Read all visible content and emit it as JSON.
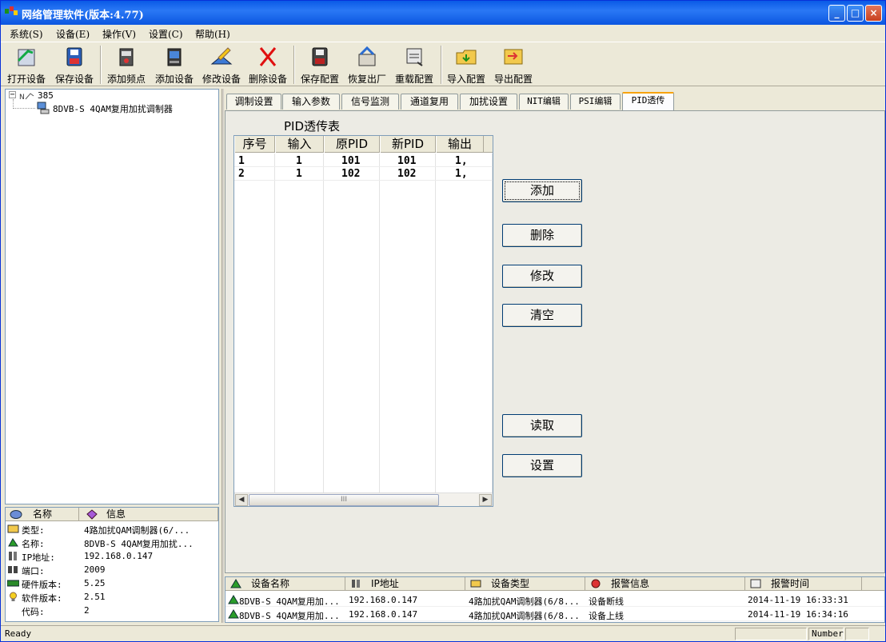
{
  "window": {
    "title": "网络管理软件(版本:4.77)",
    "minimize": "_",
    "maximize": "□",
    "close": "×"
  },
  "menu": [
    "系统(S)",
    "设备(E)",
    "操作(V)",
    "设置(C)",
    "帮助(H)"
  ],
  "toolbar": {
    "open_device": "打开设备",
    "save_device": "保存设备",
    "add_frequency": "添加频点",
    "add_device": "添加设备",
    "modify_device": "修改设备",
    "delete_device": "删除设备",
    "save_config": "保存配置",
    "factory_reset": "恢复出厂",
    "reload_config": "重载配置",
    "import_config": "导入配置",
    "export_config": "导出配置"
  },
  "tree": {
    "root_label": "385",
    "child_label": "8DVB-S 4QAM复用加扰调制器"
  },
  "properties": {
    "header_name": "名称",
    "header_info": "信息",
    "rows": [
      {
        "key": "类型:",
        "value": "4路加扰QAM调制器(6/..."
      },
      {
        "key": "名称:",
        "value": "8DVB-S 4QAM复用加扰..."
      },
      {
        "key": "IP地址:",
        "value": "192.168.0.147"
      },
      {
        "key": "端口:",
        "value": "2009"
      },
      {
        "key": "硬件版本:",
        "value": "5.25"
      },
      {
        "key": "软件版本:",
        "value": "2.51"
      },
      {
        "key": "代码:",
        "value": "2"
      }
    ]
  },
  "tabs": [
    "调制设置",
    "输入参数",
    "信号监测",
    "通道复用",
    "加扰设置",
    "NIT编辑",
    "PSI编辑",
    "PID透传"
  ],
  "pid_table": {
    "title": "PID透传表",
    "columns": [
      "序号",
      "输入",
      "原PID",
      "新PID",
      "输出"
    ],
    "rows": [
      [
        "1",
        "1",
        "101",
        "101",
        "1,"
      ],
      [
        "2",
        "1",
        "102",
        "102",
        "1,"
      ]
    ],
    "scroll_grip": "III"
  },
  "buttons": {
    "add": "添加",
    "delete": "删除",
    "modify": "修改",
    "clear": "清空",
    "read": "读取",
    "set": "设置"
  },
  "log": {
    "columns": [
      "设备名称",
      "IP地址",
      "设备类型",
      "报警信息",
      "报警时间"
    ],
    "rows": [
      [
        "8DVB-S 4QAM复用加...",
        "192.168.0.147",
        "4路加扰QAM调制器(6/8...",
        "设备断线",
        "2014-11-19 16:33:31"
      ],
      [
        "8DVB-S 4QAM复用加...",
        "192.168.0.147",
        "4路加扰QAM调制器(6/8...",
        "设备上线",
        "2014-11-19 16:34:16"
      ]
    ]
  },
  "status": {
    "text": "Ready",
    "number": "Number"
  }
}
